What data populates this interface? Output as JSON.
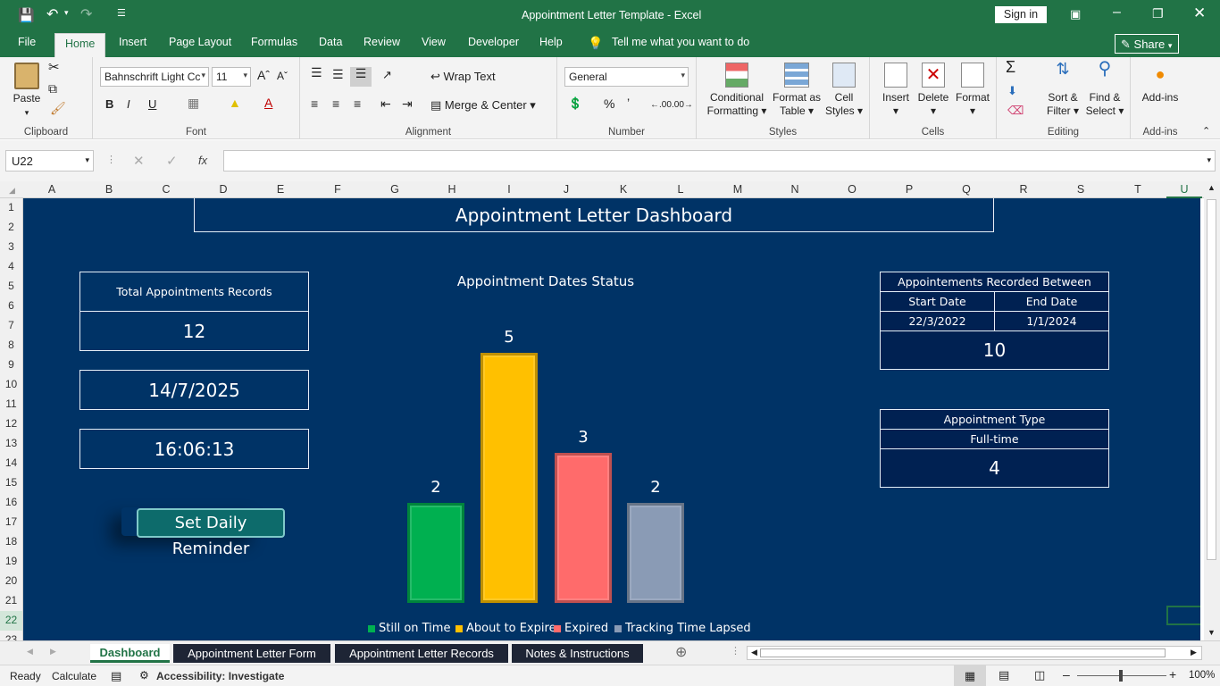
{
  "window": {
    "title": "Appointment Letter Template  -  Excel",
    "sign_in": "Sign in"
  },
  "ribbon_tabs": [
    "File",
    "Home",
    "Insert",
    "Page Layout",
    "Formulas",
    "Data",
    "Review",
    "View",
    "Developer",
    "Help"
  ],
  "tell_me": "Tell me what you want to do",
  "share": "Share",
  "ribbon": {
    "clipboard": {
      "paste": "Paste",
      "label": "Clipboard"
    },
    "font": {
      "name": "Bahnschrift Light Cc",
      "size": "11",
      "bold": "B",
      "italic": "I",
      "underline": "U",
      "label": "Font"
    },
    "alignment": {
      "wrap": "Wrap Text",
      "merge": "Merge & Center",
      "label": "Alignment"
    },
    "number": {
      "format": "General",
      "percent": "%",
      "comma": "’",
      "label": "Number"
    },
    "styles": {
      "conditional": "Conditional",
      "conditional2": "Formatting",
      "format_table": "Format as",
      "format_table2": "Table",
      "cell_styles": "Cell",
      "cell_styles2": "Styles",
      "label": "Styles"
    },
    "cells": {
      "insert": "Insert",
      "delete": "Delete",
      "format": "Format",
      "label": "Cells"
    },
    "editing": {
      "sort": "Sort &",
      "sort2": "Filter",
      "find": "Find &",
      "find2": "Select",
      "label": "Editing"
    },
    "addins": {
      "btn": "Add-ins",
      "label": "Add-ins"
    }
  },
  "formula_bar": {
    "name_box": "U22",
    "fx": "fx",
    "value": ""
  },
  "columns": [
    "A",
    "B",
    "C",
    "D",
    "E",
    "F",
    "G",
    "H",
    "I",
    "J",
    "K",
    "L",
    "M",
    "N",
    "O",
    "P",
    "Q",
    "R",
    "S",
    "T",
    "U"
  ],
  "rows": [
    "1",
    "2",
    "3",
    "4",
    "5",
    "6",
    "7",
    "8",
    "9",
    "10",
    "11",
    "12",
    "13",
    "14",
    "15",
    "16",
    "17",
    "18",
    "19",
    "20",
    "21",
    "22",
    "23"
  ],
  "dashboard": {
    "title": "Appointment Letter Dashboard",
    "total_label": "Total Appointments Records",
    "total_value": "12",
    "date": "14/7/2025",
    "time": "16:06:13",
    "reminder_button": "Set Daily Reminder",
    "recorded_between": "Appointements  Recorded Between",
    "start_label": "Start Date",
    "end_label": "End Date",
    "start_value": "22/3/2022",
    "end_value": "1/1/2024",
    "between_count": "10",
    "type_label": "Appointment Type",
    "type_value": "Full-time",
    "type_count": "4"
  },
  "chart_data": {
    "type": "bar",
    "title": "Appointment Dates Status",
    "categories": [
      "Still on Time",
      "About to Expire",
      "Expired",
      "Tracking Time Lapsed"
    ],
    "values": [
      2,
      5,
      3,
      2
    ],
    "colors": [
      "#00b050",
      "#ffc000",
      "#ff6b6b",
      "#8a9bb5"
    ],
    "legend_position": "bottom",
    "grid": false
  },
  "sheet_tabs": [
    "Dashboard",
    "Appointment Letter Form",
    "Appointment Letter Records",
    "Notes & Instructions"
  ],
  "status": {
    "ready": "Ready",
    "calculate": "Calculate",
    "accessibility": "Accessibility: Investigate",
    "zoom": "100%"
  }
}
